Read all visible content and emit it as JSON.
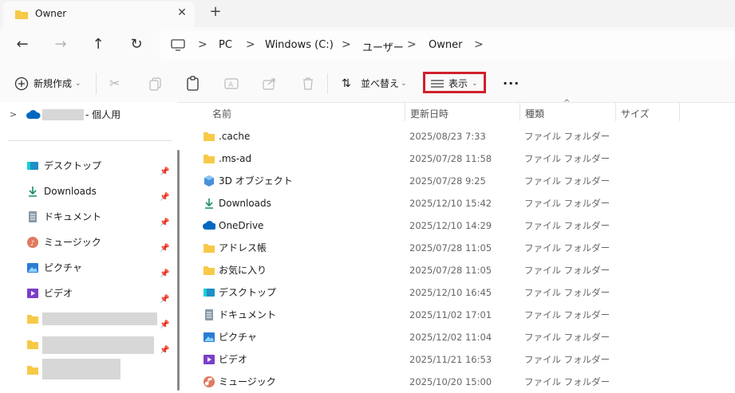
{
  "tab": {
    "title": "Owner"
  },
  "breadcrumb": [
    "PC",
    "Windows (C:)",
    "ユーザー",
    "Owner"
  ],
  "toolbar": {
    "new_label": "新規作成",
    "sort_label": "並べ替え",
    "view_label": "表示",
    "more_label": "..."
  },
  "nav": {
    "onedrive_suffix": "- 個人用",
    "items": [
      {
        "label": "デスクトップ",
        "icon": "desktop-icon"
      },
      {
        "label": "Downloads",
        "icon": "download-icon"
      },
      {
        "label": "ドキュメント",
        "icon": "document-icon"
      },
      {
        "label": "ミュージック",
        "icon": "music-icon"
      },
      {
        "label": "ピクチャ",
        "icon": "picture-icon"
      },
      {
        "label": "ビデオ",
        "icon": "video-icon"
      }
    ]
  },
  "columns": {
    "name": "名前",
    "date": "更新日時",
    "type": "種類",
    "size": "サイズ"
  },
  "files": [
    {
      "name": ".cache",
      "date": "2025/08/23 7:33",
      "type": "ファイル フォルダー",
      "icon": "folder-icon"
    },
    {
      "name": ".ms-ad",
      "date": "2025/07/28 11:58",
      "type": "ファイル フォルダー",
      "icon": "folder-icon"
    },
    {
      "name": "3D オブジェクト",
      "date": "2025/07/28 9:25",
      "type": "ファイル フォルダー",
      "icon": "cube-icon"
    },
    {
      "name": "Downloads",
      "date": "2025/12/10 15:42",
      "type": "ファイル フォルダー",
      "icon": "download-icon"
    },
    {
      "name": "OneDrive",
      "date": "2025/12/10 14:29",
      "type": "ファイル フォルダー",
      "icon": "cloud-icon"
    },
    {
      "name": "アドレス帳",
      "date": "2025/07/28 11:05",
      "type": "ファイル フォルダー",
      "icon": "folder-icon"
    },
    {
      "name": "お気に入り",
      "date": "2025/07/28 11:05",
      "type": "ファイル フォルダー",
      "icon": "folder-icon"
    },
    {
      "name": "デスクトップ",
      "date": "2025/12/10 16:45",
      "type": "ファイル フォルダー",
      "icon": "desktop-icon"
    },
    {
      "name": "ドキュメント",
      "date": "2025/11/02 17:01",
      "type": "ファイル フォルダー",
      "icon": "document-icon"
    },
    {
      "name": "ピクチャ",
      "date": "2025/12/02 11:04",
      "type": "ファイル フォルダー",
      "icon": "picture-icon"
    },
    {
      "name": "ビデオ",
      "date": "2025/11/21 16:53",
      "type": "ファイル フォルダー",
      "icon": "video-icon"
    },
    {
      "name": "ミュージック",
      "date": "2025/10/20 15:00",
      "type": "ファイル フォルダー",
      "icon": "music-icon"
    }
  ],
  "colors": {
    "highlight_border": "#d0202a",
    "folder": "#f7c948",
    "accent": "#0067c0"
  }
}
